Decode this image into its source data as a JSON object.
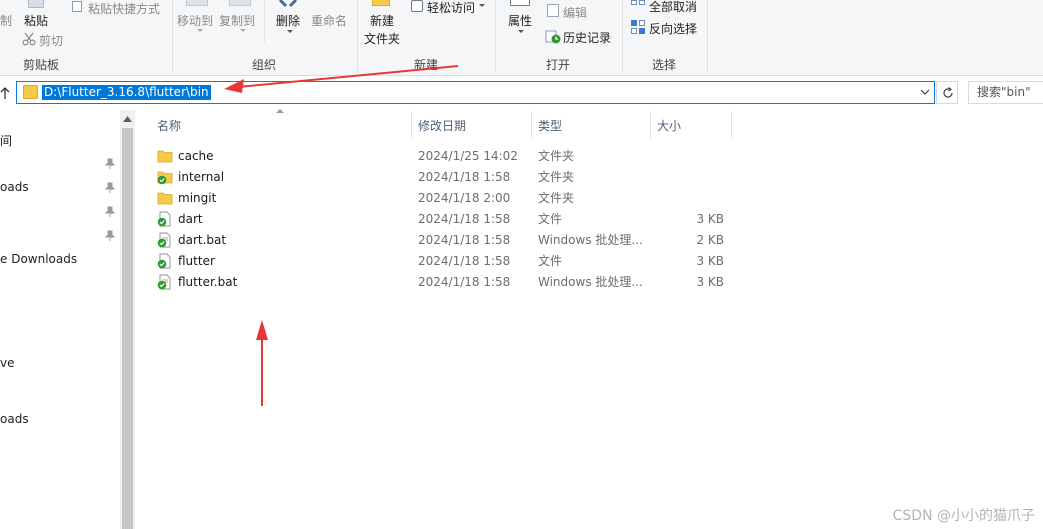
{
  "ribbon": {
    "clipboard": {
      "cut_partial": "制",
      "paste": "粘贴",
      "paste_shortcut": "粘贴快捷方式",
      "cut": "剪切",
      "group": "剪贴板"
    },
    "organize": {
      "move_to": "移动到",
      "copy_to": "复制到",
      "delete": "删除",
      "rename": "重命名",
      "group": "组织"
    },
    "new": {
      "new_folder_line1": "新建",
      "new_folder_line2": "文件夹",
      "easy_access": "轻松访问",
      "group": "新建"
    },
    "open": {
      "properties": "属性",
      "edit": "编辑",
      "history": "历史记录",
      "group": "打开"
    },
    "select": {
      "select_none": "全部取消",
      "invert": "反向选择",
      "group": "选择"
    }
  },
  "address": {
    "path": "D:\\Flutter_3.16.8\\flutter\\bin",
    "search_placeholder": "搜索\"bin\""
  },
  "nav": {
    "items": [
      "间",
      "oads",
      "e Downloads",
      "ve",
      "oads"
    ]
  },
  "columns": {
    "name": "名称",
    "date": "修改日期",
    "type": "类型",
    "size": "大小"
  },
  "files": [
    {
      "name": "cache",
      "date": "2024/1/25 14:02",
      "type": "文件夹",
      "size": "",
      "icon": "folder-icon"
    },
    {
      "name": "internal",
      "date": "2024/1/18 1:58",
      "type": "文件夹",
      "size": "",
      "icon": "folder-synced-icon"
    },
    {
      "name": "mingit",
      "date": "2024/1/18 2:00",
      "type": "文件夹",
      "size": "",
      "icon": "folder-icon"
    },
    {
      "name": "dart",
      "date": "2024/1/18 1:58",
      "type": "文件",
      "size": "3 KB",
      "icon": "file-synced-icon"
    },
    {
      "name": "dart.bat",
      "date": "2024/1/18 1:58",
      "type": "Windows 批处理...",
      "size": "2 KB",
      "icon": "batch-file-synced-icon"
    },
    {
      "name": "flutter",
      "date": "2024/1/18 1:58",
      "type": "文件",
      "size": "3 KB",
      "icon": "file-synced-icon"
    },
    {
      "name": "flutter.bat",
      "date": "2024/1/18 1:58",
      "type": "Windows 批处理...",
      "size": "3 KB",
      "icon": "batch-file-synced-icon"
    }
  ],
  "watermark": "CSDN @小小的猫爪子",
  "colors": {
    "accent": "#0078d7",
    "folder": "#f7c948",
    "sync_check": "#2e9a2e",
    "arrow": "#e53935"
  }
}
